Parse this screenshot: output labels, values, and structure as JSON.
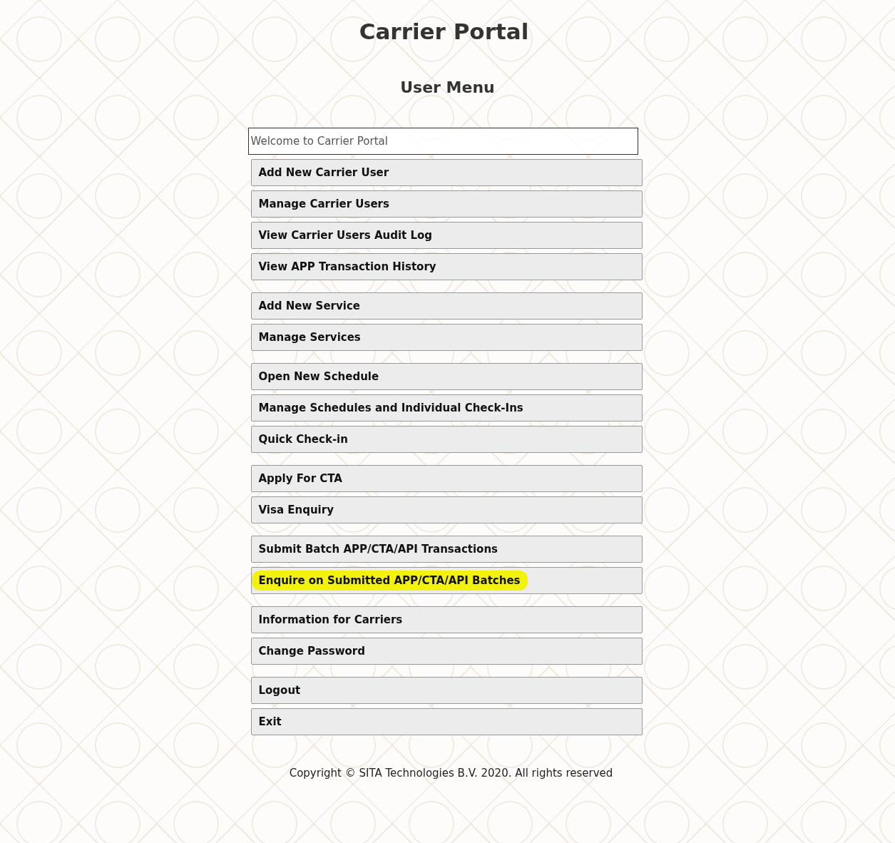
{
  "title": "Carrier Portal",
  "subtitle": "User Menu",
  "welcome_field": {
    "value": "Welcome to Carrier Portal"
  },
  "menu_groups": [
    {
      "items": [
        {
          "label": "Add New Carrier User",
          "highlighted": false
        },
        {
          "label": "Manage Carrier Users",
          "highlighted": false
        },
        {
          "label": "View Carrier Users Audit Log",
          "highlighted": false
        },
        {
          "label": "View APP Transaction History",
          "highlighted": false
        }
      ]
    },
    {
      "items": [
        {
          "label": "Add New Service",
          "highlighted": false
        },
        {
          "label": "Manage Services",
          "highlighted": false
        }
      ]
    },
    {
      "items": [
        {
          "label": "Open New Schedule",
          "highlighted": false
        },
        {
          "label": "Manage Schedules and Individual Check-Ins",
          "highlighted": false
        },
        {
          "label": "Quick Check-in",
          "highlighted": false
        }
      ]
    },
    {
      "items": [
        {
          "label": "Apply For CTA",
          "highlighted": false
        },
        {
          "label": "Visa Enquiry",
          "highlighted": false
        }
      ]
    },
    {
      "items": [
        {
          "label": "Submit Batch APP/CTA/API Transactions",
          "highlighted": false
        },
        {
          "label": "Enquire on Submitted APP/CTA/API Batches",
          "highlighted": true
        }
      ]
    },
    {
      "items": [
        {
          "label": "Information for Carriers",
          "highlighted": false
        },
        {
          "label": "Change Password",
          "highlighted": false
        }
      ]
    },
    {
      "items": [
        {
          "label": "Logout",
          "highlighted": false
        },
        {
          "label": "Exit",
          "highlighted": false
        }
      ]
    }
  ],
  "footer": "Copyright © SITA Technologies B.V. 2020. All rights reserved"
}
